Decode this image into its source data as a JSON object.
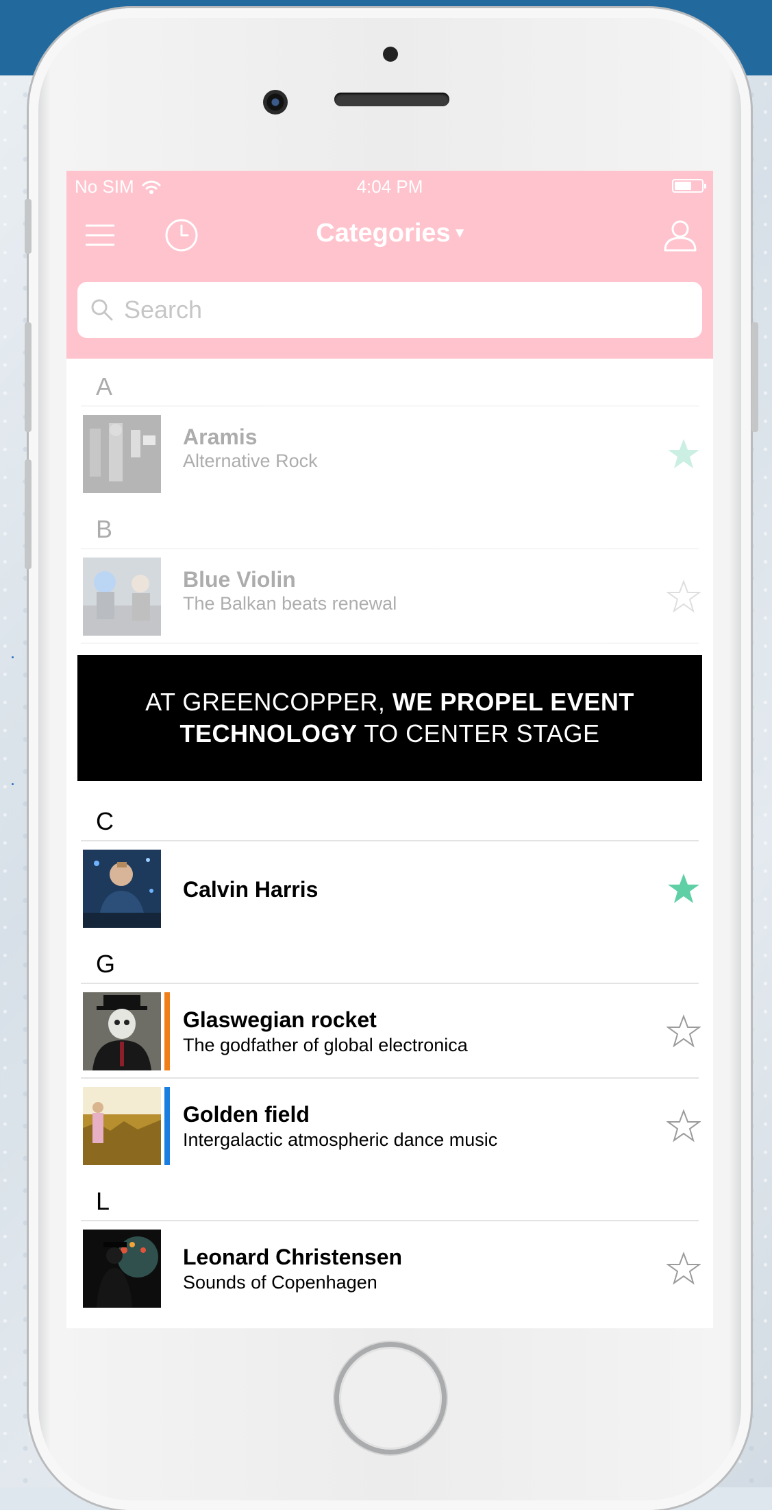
{
  "status_bar": {
    "carrier": "No SIM",
    "time": "4:04 PM"
  },
  "nav": {
    "title": "Categories",
    "title_caret": "▾"
  },
  "search": {
    "placeholder": "Search"
  },
  "sections": {
    "a": {
      "letter": "A"
    },
    "b": {
      "letter": "B"
    },
    "c": {
      "letter": "C"
    },
    "g": {
      "letter": "G"
    },
    "l": {
      "letter": "L"
    }
  },
  "items": {
    "aramis": {
      "name": "Aramis",
      "subtitle": "Alternative Rock",
      "favorite": true,
      "thumb_icon": "band-photo"
    },
    "blue_violin": {
      "name": "Blue Violin",
      "subtitle": "The Balkan beats renewal",
      "favorite": false,
      "thumb_icon": "violinist-photo"
    },
    "calvin_harris": {
      "name": "Calvin Harris",
      "subtitle": "",
      "favorite": true,
      "thumb_icon": "dj-photo"
    },
    "glaswegian_rocket": {
      "name": "Glaswegian rocket",
      "subtitle": "The godfather of global electronica",
      "favorite": false,
      "category_color": "#f07f1a",
      "thumb_icon": "masked-man-photo"
    },
    "golden_field": {
      "name": "Golden field",
      "subtitle": "Intergalactic atmospheric dance music",
      "favorite": false,
      "category_color": "#1a7ee0",
      "thumb_icon": "field-photo"
    },
    "leonard_christensen": {
      "name": "Leonard Christensen",
      "subtitle": "Sounds of Copenhagen",
      "favorite": false,
      "thumb_icon": "singer-photo"
    }
  },
  "banner": {
    "line1_regular": "AT GREENCOPPER, ",
    "line1_bold": "WE PROPEL EVENT",
    "line2_bold": "TECHNOLOGY",
    "line2_regular": " TO CENTER STAGE"
  },
  "colors": {
    "header_pink": "#ffc3cd",
    "star_filled": "#5fcfa6",
    "star_outline": "#9b9b9b",
    "background_blue": "#22699e"
  }
}
